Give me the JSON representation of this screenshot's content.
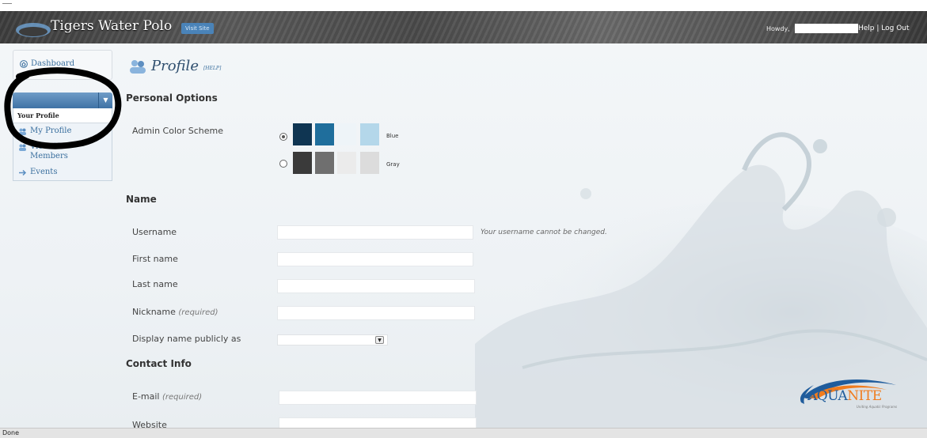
{
  "header": {
    "site_title": "Tigers Water Polo",
    "visit_site": "Visit Site",
    "howdy": "Howdy,",
    "links": "Help | Log Out"
  },
  "sidebar": {
    "dashboard": "Dashboard",
    "current_section": "Your Profile",
    "items": [
      {
        "label": "My Profile"
      },
      {
        "label": "View All Members"
      },
      {
        "label": "Events"
      }
    ]
  },
  "page": {
    "title": "Profile",
    "help": "[HELP]"
  },
  "personal_options": {
    "heading": "Personal Options",
    "admin_color_label": "Admin Color Scheme",
    "schemes": [
      {
        "name": "Blue",
        "selected": true,
        "colors": [
          "#0f3552",
          "#1f6e9c",
          "#eef4f8",
          "#b4d7ea"
        ]
      },
      {
        "name": "Gray",
        "selected": false,
        "colors": [
          "#3a3a3a",
          "#6f6f6f",
          "#ebebeb",
          "#dcdcdc"
        ]
      }
    ]
  },
  "name_section": {
    "heading": "Name",
    "username_label": "Username",
    "username_value": "",
    "username_hint": "Your username cannot be changed.",
    "first_name_label": "First name",
    "first_name_value": "",
    "last_name_label": "Last name",
    "last_name_value": "",
    "nickname_label": "Nickname",
    "nickname_required": "(required)",
    "nickname_value": "",
    "display_label": "Display name publicly as",
    "display_value": ""
  },
  "contact": {
    "heading": "Contact Info",
    "email_label": "E-mail",
    "email_required": "(required)",
    "email_value": "",
    "website_label": "Website",
    "website_value": ""
  },
  "brand": {
    "name_a": "AQUA",
    "name_b": "NITE",
    "tagline": "Uniting Aquatic Programs"
  },
  "status": {
    "text": "Done"
  },
  "colors": {
    "accent": "#3a6f9e",
    "header_bg": "#4a4a4a",
    "brand_blue": "#1f5c9c",
    "brand_orange": "#f07c1e"
  },
  "icons": [
    "home-icon",
    "people-icon",
    "events-icon",
    "profile-icon",
    "chevron-down-icon"
  ]
}
